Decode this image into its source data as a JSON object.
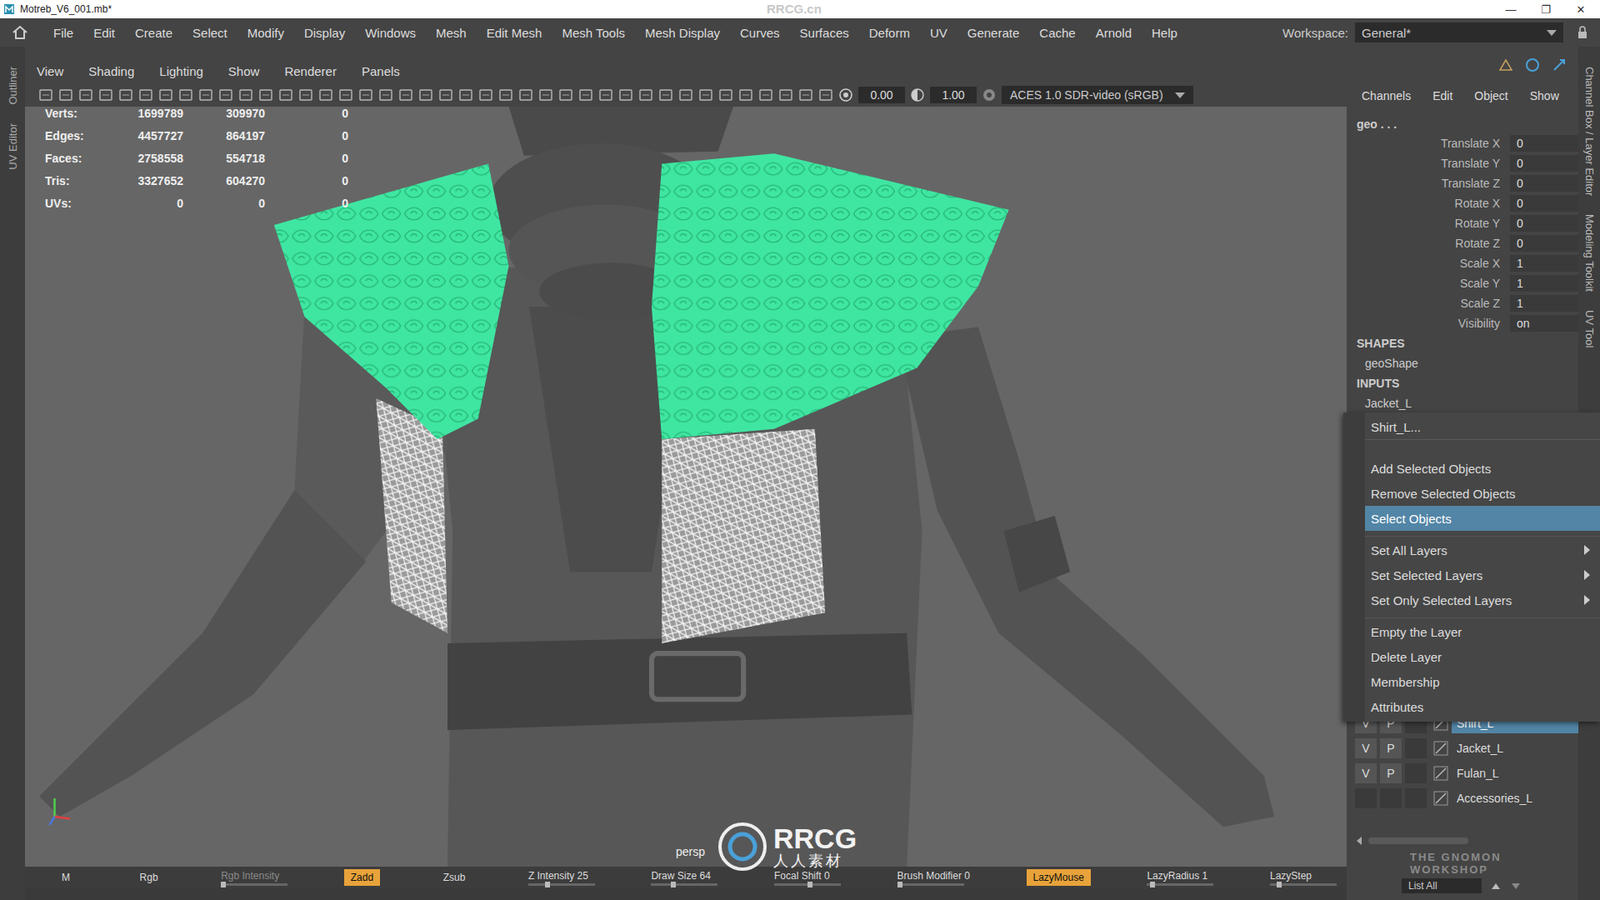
{
  "window": {
    "title": "Motreb_V6_001.mb*",
    "controls": [
      "—",
      "❐",
      "✕"
    ]
  },
  "watermarks": {
    "title": "RRCG.cn",
    "logo": "RRCG",
    "logo_cn": "人人素材",
    "gnomon": "THE GNOMON WORKSHOP"
  },
  "menu": [
    "File",
    "Edit",
    "Create",
    "Select",
    "Modify",
    "Display",
    "Windows",
    "Mesh",
    "Edit Mesh",
    "Mesh Tools",
    "Mesh Display",
    "Curves",
    "Surfaces",
    "Deform",
    "UV",
    "Generate",
    "Cache",
    "Arnold",
    "Help"
  ],
  "workspace": {
    "label": "Workspace:",
    "value": "General*"
  },
  "left_tabs": [
    "Outliner",
    "UV Editor"
  ],
  "right_tabs": [
    "Channel Box / Layer Editor",
    "Modeling Toolkit",
    "UV Tool"
  ],
  "viewport": {
    "menus": [
      "View",
      "Shading",
      "Lighting",
      "Show",
      "Renderer",
      "Panels"
    ],
    "exposure": "0.00",
    "gamma": "1.00",
    "color_space": "ACES 1.0 SDR-video (sRGB)",
    "camera": "persp",
    "hud": [
      {
        "label": "Verts:",
        "values": [
          "1699789",
          "309970",
          "0"
        ]
      },
      {
        "label": "Edges:",
        "values": [
          "4457727",
          "864197",
          "0"
        ]
      },
      {
        "label": "Faces:",
        "values": [
          "2758558",
          "554718",
          "0"
        ]
      },
      {
        "label": "Tris:",
        "values": [
          "3327652",
          "604270",
          "0"
        ]
      },
      {
        "label": "UVs:",
        "values": [
          "0",
          "0",
          "0"
        ]
      }
    ]
  },
  "sculpt_bar": [
    {
      "label": "M",
      "kind": "toggle",
      "active": false,
      "disabled": false
    },
    {
      "label": "Rgb",
      "kind": "toggle",
      "active": false,
      "disabled": false
    },
    {
      "label": "Rgb Intensity",
      "kind": "slider",
      "active": false,
      "disabled": true,
      "level": 0.0
    },
    {
      "label": "Zadd",
      "kind": "toggle",
      "active": true,
      "disabled": false
    },
    {
      "label": "Zsub",
      "kind": "toggle",
      "active": false,
      "disabled": false
    },
    {
      "label": "Z Intensity 25",
      "kind": "slider",
      "active": false,
      "disabled": false,
      "level": 0.25
    },
    {
      "label": "Draw Size 64",
      "kind": "slider",
      "active": false,
      "disabled": false,
      "level": 0.3
    },
    {
      "label": "Focal Shift 0",
      "kind": "slider",
      "active": false,
      "disabled": false,
      "level": 0.5
    },
    {
      "label": "Brush Modifier 0",
      "kind": "slider",
      "active": false,
      "disabled": false,
      "level": 0.0
    },
    {
      "label": "LazyMouse",
      "kind": "toggle",
      "active": true,
      "disabled": false
    },
    {
      "label": "LazyRadius 1",
      "kind": "slider",
      "active": false,
      "disabled": false,
      "level": 0.05
    },
    {
      "label": "LazyStep",
      "kind": "slider",
      "active": false,
      "disabled": false,
      "level": 0.1
    }
  ],
  "channel_box": {
    "tabs": [
      "Channels",
      "Edit",
      "Object",
      "Show"
    ],
    "object": "geo . . .",
    "attributes": [
      {
        "name": "Translate X",
        "value": "0"
      },
      {
        "name": "Translate Y",
        "value": "0"
      },
      {
        "name": "Translate Z",
        "value": "0"
      },
      {
        "name": "Rotate X",
        "value": "0"
      },
      {
        "name": "Rotate Y",
        "value": "0"
      },
      {
        "name": "Rotate Z",
        "value": "0"
      },
      {
        "name": "Scale X",
        "value": "1"
      },
      {
        "name": "Scale Y",
        "value": "1"
      },
      {
        "name": "Scale Z",
        "value": "1"
      },
      {
        "name": "Visibility",
        "value": "on"
      }
    ],
    "shapes_header": "SHAPES",
    "shape": "geoShape",
    "inputs_header": "INPUTS",
    "inputs": [
      "Jacket_L"
    ]
  },
  "context_menu": {
    "title": "Shirt_L...",
    "groups": [
      [
        {
          "label": "Add Selected Objects",
          "submenu": false,
          "selected": false
        },
        {
          "label": "Remove Selected Objects",
          "submenu": false,
          "selected": false
        },
        {
          "label": "Select Objects",
          "submenu": false,
          "selected": true
        }
      ],
      [
        {
          "label": "Set All Layers",
          "submenu": true,
          "selected": false
        },
        {
          "label": "Set Selected Layers",
          "submenu": true,
          "selected": false
        },
        {
          "label": "Set Only Selected Layers",
          "submenu": true,
          "selected": false
        }
      ],
      [
        {
          "label": "Empty the Layer",
          "submenu": false,
          "selected": false
        },
        {
          "label": "Delete Layer",
          "submenu": false,
          "selected": false
        },
        {
          "label": "Membership",
          "submenu": false,
          "selected": false
        },
        {
          "label": "Attributes",
          "submenu": false,
          "selected": false
        }
      ]
    ]
  },
  "layer_editor": {
    "v_label": "V",
    "p_label": "P",
    "list_all": "List All",
    "layers": [
      {
        "name": "Shirt_L",
        "visible": true,
        "playback": true,
        "selected": true
      },
      {
        "name": "Jacket_L",
        "visible": true,
        "playback": true,
        "selected": false
      },
      {
        "name": "Fulan_L",
        "visible": true,
        "playback": true,
        "selected": false
      },
      {
        "name": "Accessories_L",
        "visible": false,
        "playback": false,
        "selected": false
      }
    ]
  }
}
